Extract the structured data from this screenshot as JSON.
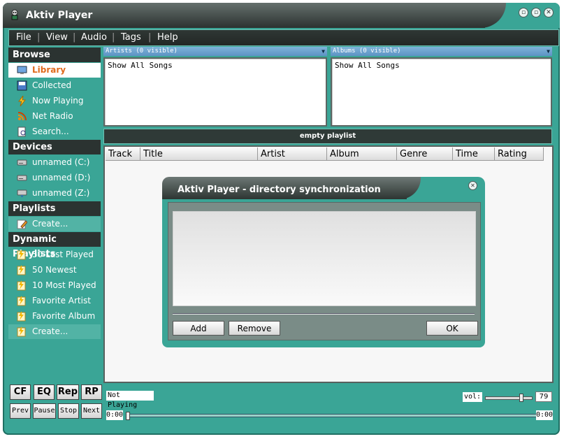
{
  "window": {
    "title": "Aktiv Player"
  },
  "window_buttons": [
    "▫",
    "▫",
    "✕"
  ],
  "menu": [
    "File",
    "View",
    "Audio",
    "Tags",
    "Help"
  ],
  "sidebar": {
    "browse": {
      "heading": "Browse",
      "items": [
        {
          "label": "Library",
          "icon": "monitor-icon"
        },
        {
          "label": "Collected",
          "icon": "disk-icon"
        },
        {
          "label": "Now Playing",
          "icon": "lightning-icon"
        },
        {
          "label": "Net Radio",
          "icon": "radio-icon"
        },
        {
          "label": "Search...",
          "icon": "search-icon"
        }
      ]
    },
    "devices": {
      "heading": "Devices",
      "items": [
        {
          "label": "unnamed (C:)",
          "icon": "drive-icon"
        },
        {
          "label": "unnamed (D:)",
          "icon": "drive-icon"
        },
        {
          "label": "unnamed (Z:)",
          "icon": "drive-icon"
        }
      ]
    },
    "playlists": {
      "heading": "Playlists",
      "items": [
        {
          "label": "Create...",
          "icon": "pencil-icon"
        }
      ]
    },
    "dynamic": {
      "heading": "Dynamic Playlists",
      "items": [
        {
          "label": "50 Last Played",
          "icon": "playlist-icon"
        },
        {
          "label": "50 Newest",
          "icon": "playlist-icon"
        },
        {
          "label": "10 Most Played",
          "icon": "playlist-icon"
        },
        {
          "label": "Favorite Artist",
          "icon": "playlist-icon"
        },
        {
          "label": "Favorite Album",
          "icon": "playlist-icon"
        },
        {
          "label": "Create...",
          "icon": "playlist-icon"
        }
      ]
    }
  },
  "filters": {
    "artists": {
      "header": "Artists (0 visible)",
      "item": "Show All Songs"
    },
    "albums": {
      "header": "Albums (0 visible)",
      "item": "Show All Songs"
    }
  },
  "playlist": {
    "status": "empty playlist",
    "columns": [
      "Track",
      "Title",
      "Artist",
      "Album",
      "Genre",
      "Time",
      "Rating"
    ]
  },
  "dialog": {
    "title": "Aktiv Player - directory synchronization",
    "add": "Add",
    "remove": "Remove",
    "ok": "OK"
  },
  "controls": {
    "cf": "CF",
    "eq": "EQ",
    "rep": "Rep",
    "rp": "RP",
    "prev": "Prev",
    "pause": "Pause",
    "stop": "Stop",
    "next": "Next",
    "status": "Not Playing",
    "vol_label": "vol:",
    "vol_value": "79",
    "vol_level_percent": 79,
    "time_start": "0:00",
    "time_end": "0:00",
    "seek_percent": 0
  },
  "colors": {
    "accent": "#3aa596",
    "active_text": "#e06a1c",
    "dark": "#2b3331"
  }
}
